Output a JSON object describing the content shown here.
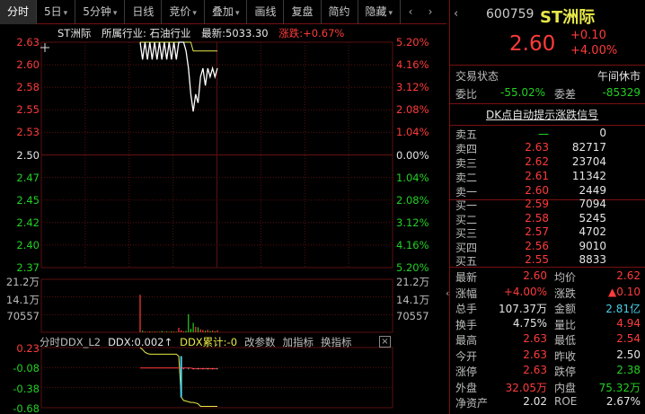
{
  "toolbar": {
    "tabs": [
      {
        "label": "分时",
        "active": true
      },
      {
        "label": "5日",
        "dropdown": true
      },
      {
        "label": "5分钟",
        "dropdown": true
      },
      {
        "label": "日线"
      },
      {
        "label": "竞价",
        "dropdown": true
      },
      {
        "label": "叠加",
        "dropdown": true
      },
      {
        "label": "画线"
      },
      {
        "label": "复盘"
      },
      {
        "label": "简约"
      },
      {
        "label": "隐藏",
        "dropdown": true
      }
    ],
    "prev": "‹",
    "next": "›"
  },
  "chart": {
    "stock_name": "ST洲际",
    "industry": "所属行业: 石油行业",
    "latest": "最新:5033.30",
    "change": "涨跌:+0.67%",
    "price_labels": [
      "2.63",
      "2.60",
      "2.58",
      "2.55",
      "2.53",
      "2.50",
      "2.47",
      "2.45",
      "2.42",
      "2.40",
      "2.37"
    ],
    "pct_labels": [
      "5.20%",
      "4.16%",
      "3.12%",
      "2.08%",
      "1.04%",
      "0.00%",
      "1.04%",
      "2.08%",
      "3.12%",
      "4.16%",
      "5.20%"
    ],
    "vol_labels": [
      "21.2万",
      "14.1万",
      "70557"
    ],
    "ddx_labels": [
      "0.23",
      "-0.08",
      "-0.38",
      "-0.68"
    ],
    "ddx_bar": {
      "title": "分时DDX_L2",
      "ddx": "DDX:0.002↑",
      "ddx_cum": "DDX累计:-0",
      "params": "改参数",
      "add_indicator": "加指标",
      "switch_indicator": "换指标",
      "close": "×"
    },
    "colors": {
      "up": "#ff3b3b",
      "down": "#22d022",
      "grid": "#5a0f0f",
      "price_line": "#ffffff",
      "avg_line": "#e8e84a",
      "ddx_line": "#4ad0e8"
    }
  },
  "chart_data": {
    "type": "line",
    "title": "ST洲际",
    "ylim": [
      2.37,
      2.63
    ],
    "prev_close": 2.5,
    "price": [
      2.63,
      2.61,
      2.63,
      2.61,
      2.63,
      2.61,
      2.63,
      2.61,
      2.63,
      2.61,
      2.63,
      2.61,
      2.63,
      2.61,
      2.63,
      2.61,
      2.63,
      2.63,
      2.63,
      2.62,
      2.6,
      2.57,
      2.55,
      2.57,
      2.56,
      2.59,
      2.6,
      2.58,
      2.6,
      2.59,
      2.6,
      2.59,
      2.6
    ],
    "avg_price": [
      2.63,
      2.63,
      2.63,
      2.63,
      2.63,
      2.63,
      2.63,
      2.63,
      2.63,
      2.63,
      2.63,
      2.63,
      2.63,
      2.63,
      2.63,
      2.63,
      2.63,
      2.63,
      2.63,
      2.63,
      2.63,
      2.63,
      2.62,
      2.62,
      2.62,
      2.62,
      2.62,
      2.62,
      2.62,
      2.62,
      2.62,
      2.62,
      2.62
    ],
    "volume_ylim": [
      0,
      212000
    ],
    "volume": [
      150000,
      6000,
      3000,
      2000,
      4000,
      2000,
      3000,
      2000,
      2000,
      5000,
      2000,
      3000,
      2000,
      4000,
      3000,
      2000,
      18000,
      8000,
      4000,
      6000,
      72000,
      14000,
      38000,
      22000,
      20000,
      12000,
      9000,
      6000,
      10000,
      5000,
      7000,
      4000,
      8000
    ],
    "ddx_ylim": [
      -0.68,
      0.23
    ],
    "ddx_cum": [
      -0.08,
      -0.08,
      -0.08,
      -0.08,
      -0.08,
      -0.08,
      -0.08,
      -0.08,
      -0.08,
      -0.08,
      -0.08,
      -0.08,
      -0.08,
      -0.08,
      -0.08,
      -0.08,
      -0.08,
      -0.08,
      -0.08,
      -0.08,
      -0.08,
      -0.08,
      -0.09,
      -0.09,
      -0.09,
      -0.09,
      -0.09,
      -0.09,
      -0.09,
      -0.09,
      -0.09,
      -0.09,
      -0.09
    ],
    "ddx_avg": [
      0.23,
      0.2,
      0.16,
      0.14,
      0.13,
      0.13,
      0.13,
      0.13,
      0.13,
      0.13,
      0.13,
      0.13,
      0.13,
      0.13,
      0.13,
      0.13,
      0.1,
      -0.52,
      -0.57,
      -0.58,
      -0.59,
      -0.6,
      -0.6,
      -0.61,
      -0.62,
      -0.66,
      -0.66,
      -0.66,
      -0.66,
      -0.66,
      -0.66,
      -0.66,
      -0.66
    ]
  },
  "panel": {
    "code": "600759",
    "name": "ST洲际",
    "price": "2.60",
    "change": "+0.10",
    "change_pct": "+4.00%",
    "trade_status_label": "交易状态",
    "trade_status": "午间休市",
    "wei_bi_label": "委比",
    "wei_bi": "-55.02%",
    "wei_cha_label": "委差",
    "wei_cha": "-85329",
    "dk_signal": "DK点自动提示涨跌信号",
    "asks": [
      {
        "label": "卖五",
        "price": "一",
        "vol": "0"
      },
      {
        "label": "卖四",
        "price": "2.63",
        "vol": "82717"
      },
      {
        "label": "卖三",
        "price": "2.62",
        "vol": "23704"
      },
      {
        "label": "卖二",
        "price": "2.61",
        "vol": "11342"
      },
      {
        "label": "卖一",
        "price": "2.60",
        "vol": "2449"
      }
    ],
    "bids": [
      {
        "label": "买一",
        "price": "2.59",
        "vol": "7094"
      },
      {
        "label": "买二",
        "price": "2.58",
        "vol": "5245"
      },
      {
        "label": "买三",
        "price": "2.57",
        "vol": "4702"
      },
      {
        "label": "买四",
        "price": "2.56",
        "vol": "9010"
      },
      {
        "label": "买五",
        "price": "2.55",
        "vol": "8833"
      }
    ],
    "stats": [
      {
        "l1": "最新",
        "v1": "2.60",
        "c1": "red",
        "l2": "均价",
        "v2": "2.62",
        "c2": "red"
      },
      {
        "l1": "涨幅",
        "v1": "+4.00%",
        "c1": "red",
        "l2": "涨跌",
        "v2": "▲0.10",
        "c2": "red"
      },
      {
        "l1": "总手",
        "v1": "107.37万",
        "c1": "white",
        "l2": "金额",
        "v2": "2.81亿",
        "c2": "cyan"
      },
      {
        "l1": "换手",
        "v1": "4.75%",
        "c1": "white",
        "l2": "量比",
        "v2": "4.94",
        "c2": "red"
      },
      {
        "l1": "最高",
        "v1": "2.63",
        "c1": "red",
        "l2": "最低",
        "v2": "2.54",
        "c2": "red"
      },
      {
        "l1": "今开",
        "v1": "2.63",
        "c1": "red",
        "l2": "昨收",
        "v2": "2.50",
        "c2": "white"
      },
      {
        "l1": "涨停",
        "v1": "2.63",
        "c1": "red",
        "l2": "跌停",
        "v2": "2.38",
        "c2": "green"
      },
      {
        "l1": "外盘",
        "v1": "32.05万",
        "c1": "red",
        "l2": "内盘",
        "v2": "75.32万",
        "c2": "green"
      },
      {
        "l1": "净资产",
        "v1": "2.02",
        "c1": "white",
        "l2": "ROE",
        "v2": "2.67%",
        "c2": "white"
      }
    ]
  }
}
